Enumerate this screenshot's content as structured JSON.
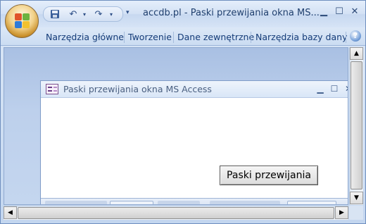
{
  "window": {
    "title": "accdb.pl - Paski przewijania okna MS...",
    "controls": {
      "minimize": "▁",
      "maximize": "☐",
      "close": "✕"
    }
  },
  "quick_access": {
    "save_icon": "save-icon",
    "undo_icon": "undo-icon",
    "redo_icon": "redo-icon",
    "customize_icon": "dropdown-icon"
  },
  "ribbon": {
    "tabs": [
      {
        "label": "Narzędzia główne"
      },
      {
        "label": "Tworzenie"
      },
      {
        "label": "Dane zewnętrzne"
      },
      {
        "label": "Narzędzia bazy dany"
      }
    ],
    "help_label": "?"
  },
  "form": {
    "title": "Paski przewijania okna MS Access",
    "controls": {
      "minimize": "▁",
      "maximize": "☐",
      "close": "✕"
    },
    "button_label": "Paski przewijania"
  },
  "colors": {
    "accent": "#153c78",
    "title_text": "#1f3f6e",
    "workspace": "#bdd0ec"
  }
}
